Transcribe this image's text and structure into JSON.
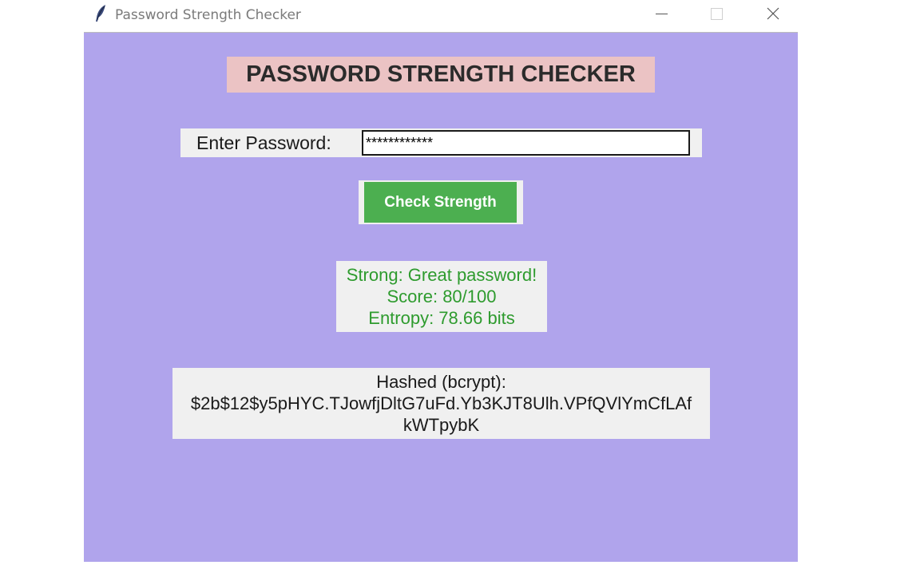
{
  "window": {
    "title": "Password Strength Checker"
  },
  "heading": "PASSWORD STRENGTH CHECKER",
  "password": {
    "label": "Enter Password:",
    "value": "************"
  },
  "check_button": "Check Strength",
  "result": {
    "verdict": "Strong: Great password!",
    "score": "Score: 80/100",
    "entropy": "Entropy: 78.66 bits"
  },
  "hash": {
    "label": "Hashed (bcrypt):",
    "line1": "$2b$12$y5pHYC.TJowfjDltG7uFd.Yb3KJT8Ulh.VPfQVlYmCfLAf",
    "line2": "kWTpybK"
  },
  "colors": {
    "background": "#b0a4ec",
    "heading_bg": "#ebc3c4",
    "button": "#4caf50",
    "result_text": "#2e9b2e"
  },
  "icons": {
    "app": "feather-icon",
    "minimize": "minimize-icon",
    "maximize": "maximize-icon",
    "close": "close-icon"
  }
}
